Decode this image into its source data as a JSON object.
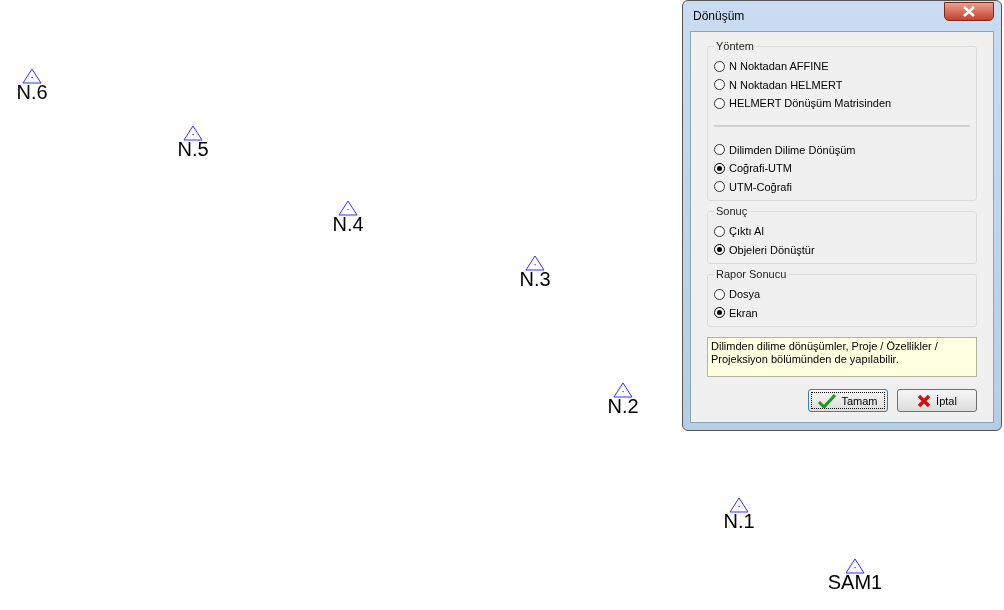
{
  "points": [
    {
      "label": "N.6"
    },
    {
      "label": "N.5"
    },
    {
      "label": "N.4"
    },
    {
      "label": "N.3"
    },
    {
      "label": "N.2"
    },
    {
      "label": "N.1"
    },
    {
      "label": "SAM1"
    }
  ],
  "dialog": {
    "title": "Dönüşüm",
    "groups": [
      {
        "title": "Yöntem",
        "sections": [
          [
            {
              "label": "N Noktadan AFFINE",
              "selected": false
            },
            {
              "label": "N Noktadan HELMERT",
              "selected": false
            },
            {
              "label": "HELMERT Dönüşüm Matrisinden",
              "selected": false
            }
          ],
          [
            {
              "label": "Dilimden Dilime Dönüşüm",
              "selected": false
            },
            {
              "label": "Coğrafi-UTM",
              "selected": true
            },
            {
              "label": "UTM-Coğrafi",
              "selected": false
            }
          ]
        ]
      },
      {
        "title": "Sonuç",
        "sections": [
          [
            {
              "label": "Çıktı Al",
              "selected": false
            },
            {
              "label": "Objeleri Dönüştür",
              "selected": true
            }
          ]
        ]
      },
      {
        "title": "Rapor Sonucu",
        "sections": [
          [
            {
              "label": "Dosya",
              "selected": false
            },
            {
              "label": "Ekran",
              "selected": true
            }
          ]
        ]
      }
    ],
    "info": "Dilimden dilime dönüşümler, Proje / Özellikler / Projeksiyon bölümünden de yapılabilir.",
    "buttons": [
      {
        "kind": "ok",
        "label": "Tamam"
      },
      {
        "kind": "cancel",
        "label": "İptal"
      }
    ]
  }
}
